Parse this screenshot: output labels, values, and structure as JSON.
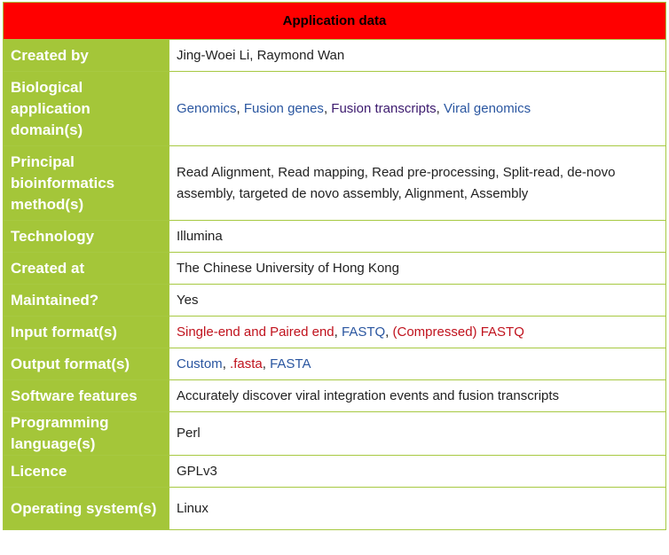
{
  "header": {
    "title": "Application data"
  },
  "colors": {
    "header_bg": "#ff0000",
    "label_bg": "#a4c639",
    "link_blue": "#2a56a0",
    "link_purple": "#3c1a6e",
    "link_red": "#c0121d"
  },
  "rows": [
    {
      "label": "Created by",
      "value": "Jing-Woei Li, Raymond Wan"
    },
    {
      "label": "Biological application domain(s)",
      "parts": [
        {
          "text": "Genomics",
          "style": "link-blue"
        },
        {
          "text": ", ",
          "style": "plain"
        },
        {
          "text": "Fusion genes",
          "style": "link-blue"
        },
        {
          "text": ", ",
          "style": "plain"
        },
        {
          "text": "Fusion transcripts",
          "style": "link-purple"
        },
        {
          "text": ", ",
          "style": "plain"
        },
        {
          "text": "Viral genomics",
          "style": "link-blue"
        }
      ]
    },
    {
      "label": "Principal bioinformatics method(s)",
      "value": "Read Alignment, Read mapping, Read pre-processing, Split-read, de-novo assembly, targeted de novo assembly, Alignment, Assembly"
    },
    {
      "label": "Technology",
      "value": "Illumina"
    },
    {
      "label": "Created at",
      "value": "The Chinese University of Hong Kong"
    },
    {
      "label": "Maintained?",
      "value": "Yes"
    },
    {
      "label": "Input format(s)",
      "parts": [
        {
          "text": "Single-end and Paired end",
          "style": "link-red"
        },
        {
          "text": ", ",
          "style": "plain"
        },
        {
          "text": "FASTQ",
          "style": "link-blue"
        },
        {
          "text": ", ",
          "style": "plain"
        },
        {
          "text": "(Compressed) FASTQ",
          "style": "link-red"
        }
      ]
    },
    {
      "label": "Output format(s)",
      "parts": [
        {
          "text": "Custom",
          "style": "link-blue"
        },
        {
          "text": ", ",
          "style": "plain"
        },
        {
          "text": ".fasta",
          "style": "link-red"
        },
        {
          "text": ", ",
          "style": "plain"
        },
        {
          "text": "FASTA",
          "style": "link-blue"
        }
      ]
    },
    {
      "label": "Software features",
      "value": "Accurately discover viral integration events and fusion transcripts"
    },
    {
      "label": "Programming language(s)",
      "value": "Perl"
    },
    {
      "label": "Licence",
      "value": "GPLv3"
    },
    {
      "label": "Operating system(s)",
      "value": "Linux"
    }
  ]
}
